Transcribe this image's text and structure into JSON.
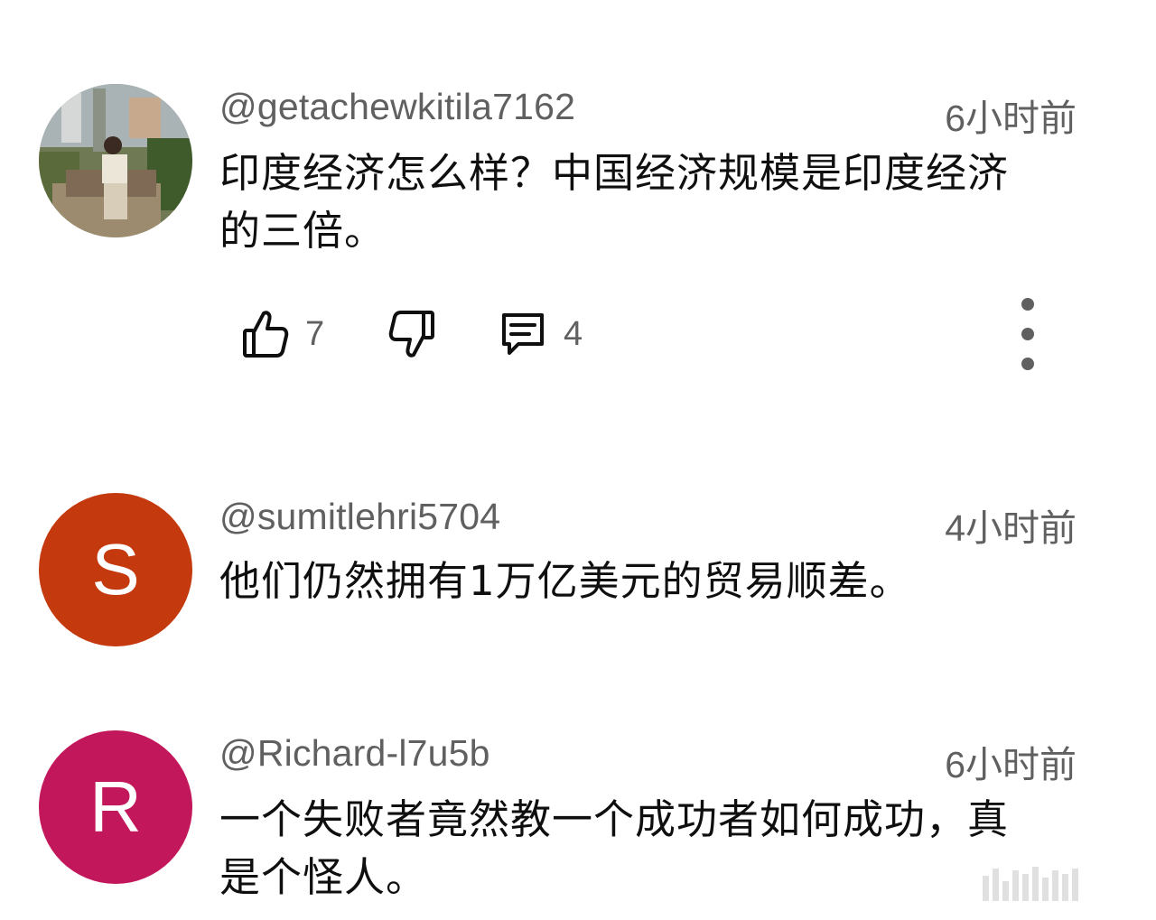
{
  "comments": [
    {
      "author": "@getachewkitila7162",
      "time": "6小时前",
      "text_lines": [
        "印度经济怎么样？中国经济规模是印度经济",
        "的三倍。"
      ],
      "likes": "7",
      "replies": "4"
    },
    {
      "author": "@sumitlehri5704",
      "time": "4小时前",
      "avatar_letter": "S",
      "avatar_color": "#c4390d",
      "text_lines": [
        "他们仍然拥有1万亿美元的贸易顺差。"
      ]
    },
    {
      "author": "@Richard-l7u5b",
      "time": "6小时前",
      "avatar_letter": "R",
      "avatar_color": "#c2185b",
      "text_lines": [
        "一个失败者竟然教一个成功者如何成功，真",
        "是个怪人。"
      ]
    }
  ],
  "icons": {
    "like": "thumb-up-icon",
    "dislike": "thumb-down-icon",
    "reply": "comment-icon",
    "more": "more-vertical-icon"
  },
  "colors": {
    "secondary_text": "#606060",
    "primary_text": "#0f0f0f"
  }
}
